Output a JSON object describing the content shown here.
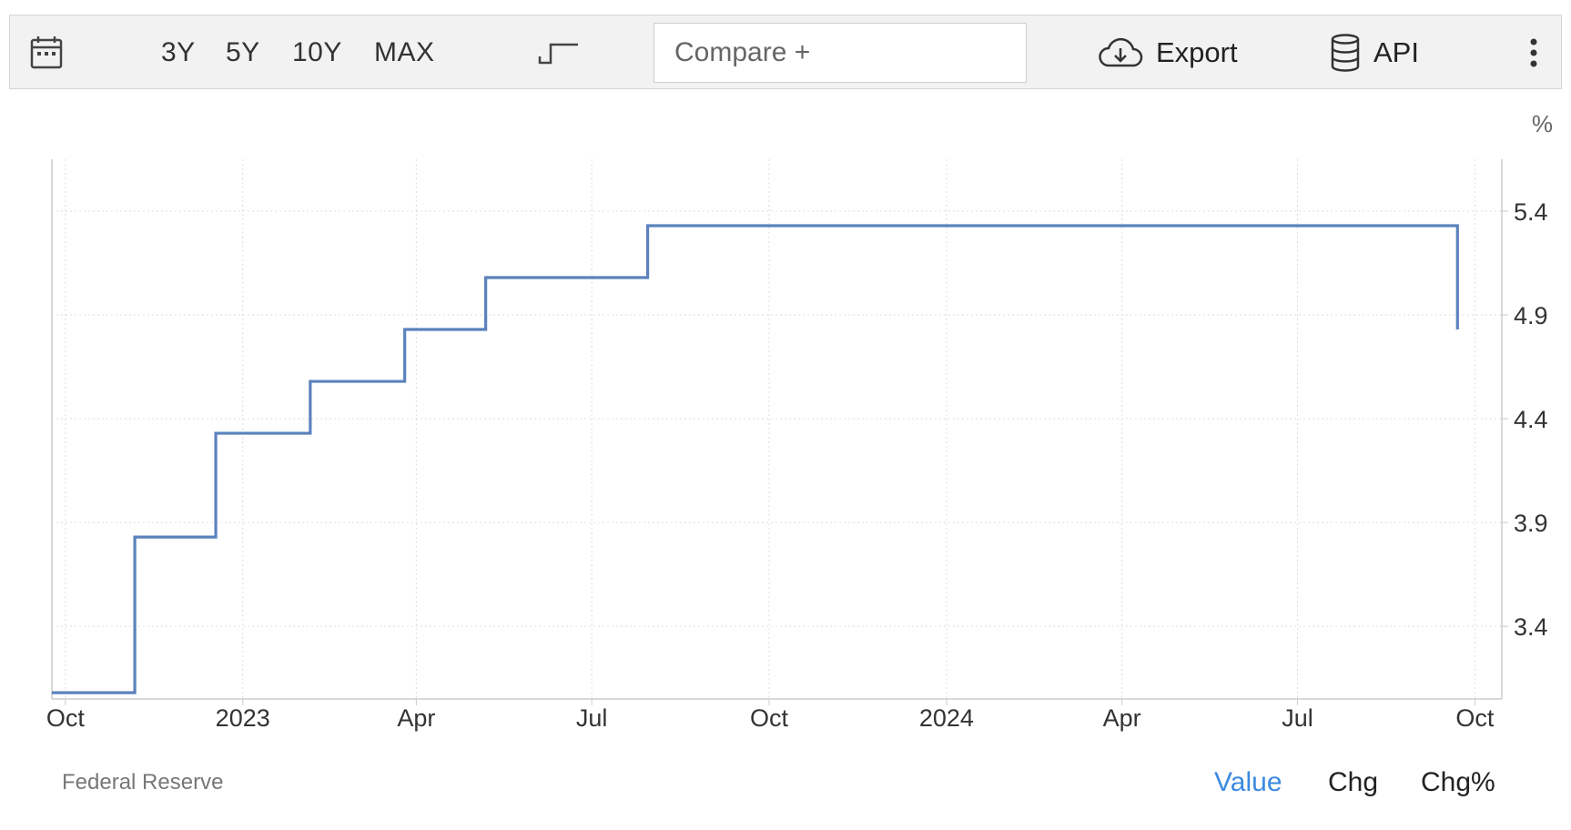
{
  "toolbar": {
    "ranges": [
      "3Y",
      "5Y",
      "10Y",
      "MAX"
    ],
    "compare_label": "Compare +",
    "export_label": "Export",
    "api_label": "API",
    "icons": [
      "calendar-icon",
      "step-chart-icon",
      "cloud-download-icon",
      "database-icon",
      "more-vertical-icon"
    ]
  },
  "footer": {
    "source": "Federal Reserve",
    "tabs": [
      "Value",
      "Chg",
      "Chg%"
    ],
    "active_tab": "Value"
  },
  "colors": {
    "line": "#5b82bd",
    "active_tab": "#3b8ae0",
    "grid": "#dddddd"
  },
  "chart_data": {
    "type": "line",
    "step": true,
    "title": "",
    "xlabel": "",
    "ylabel": "%",
    "ylim": [
      3.05,
      5.65
    ],
    "xlim": [
      "2022-09-24",
      "2024-10-15"
    ],
    "y_ticks": [
      3.4,
      3.9,
      4.4,
      4.9,
      5.4
    ],
    "x_ticks": [
      {
        "date": "2022-10-01",
        "label": "Oct"
      },
      {
        "date": "2023-01-01",
        "label": "2023"
      },
      {
        "date": "2023-04-01",
        "label": "Apr"
      },
      {
        "date": "2023-07-01",
        "label": "Jul"
      },
      {
        "date": "2023-10-01",
        "label": "Oct"
      },
      {
        "date": "2024-01-01",
        "label": "2024"
      },
      {
        "date": "2024-04-01",
        "label": "Apr"
      },
      {
        "date": "2024-07-01",
        "label": "Jul"
      },
      {
        "date": "2024-10-01",
        "label": "Oct"
      }
    ],
    "grid": true,
    "y_axis_side": "right",
    "series": [
      {
        "x": [
          "2022-09-24",
          "2022-11-06",
          "2022-12-18",
          "2023-02-05",
          "2023-03-26",
          "2023-05-07",
          "2023-07-30",
          "2024-09-22"
        ],
        "y": [
          3.08,
          3.83,
          4.33,
          4.58,
          4.83,
          5.08,
          5.33,
          4.83
        ]
      }
    ]
  }
}
